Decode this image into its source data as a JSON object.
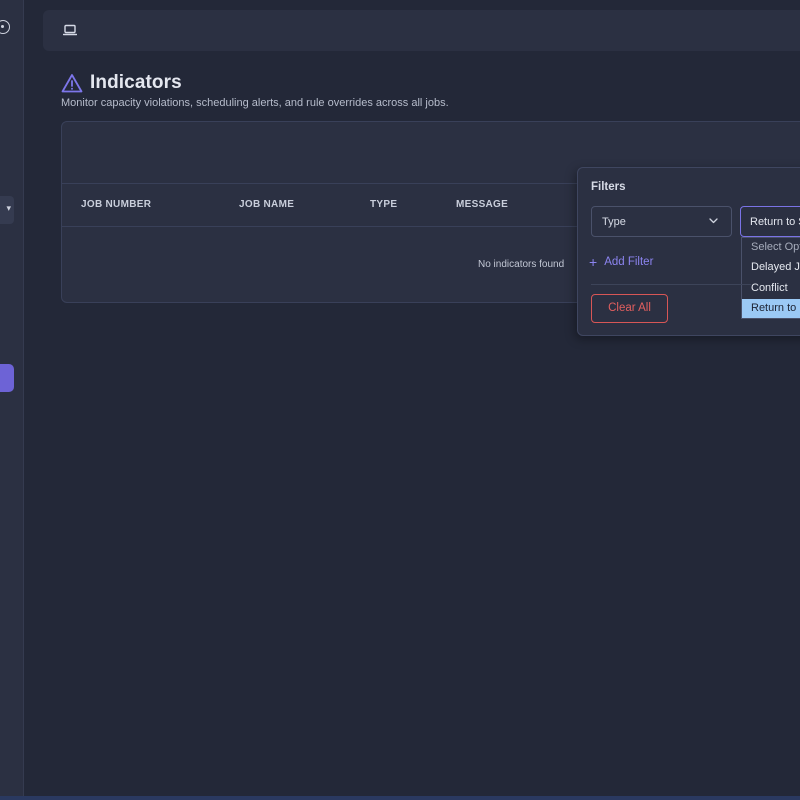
{
  "page": {
    "title": "Indicators",
    "subtitle": "Monitor capacity violations, scheduling alerts, and rule overrides across all jobs."
  },
  "table": {
    "columns": [
      "JOB NUMBER",
      "JOB NAME",
      "TYPE",
      "MESSAGE"
    ],
    "empty_message": "No indicators found"
  },
  "filters": {
    "title": "Filters",
    "field_select": {
      "value": "Type"
    },
    "value_select": {
      "value": "Return to S"
    },
    "options": [
      "Select Opt",
      "Delayed J",
      "Conflict",
      "Return to"
    ],
    "selected_option_index": 3,
    "add_filter_label": "Add Filter",
    "clear_all_label": "Clear All"
  },
  "icons": {
    "sidebar_top": "circle-dot-icon",
    "topbar": "laptop-icon",
    "title": "warning-icon",
    "add_filter": "plus-icon",
    "select_chevron": "chevron-down-icon"
  },
  "colors": {
    "accent": "#6d63d6",
    "link": "#8c84f0",
    "danger": "#e35f5f",
    "selected_option": "#9bc9f5"
  }
}
